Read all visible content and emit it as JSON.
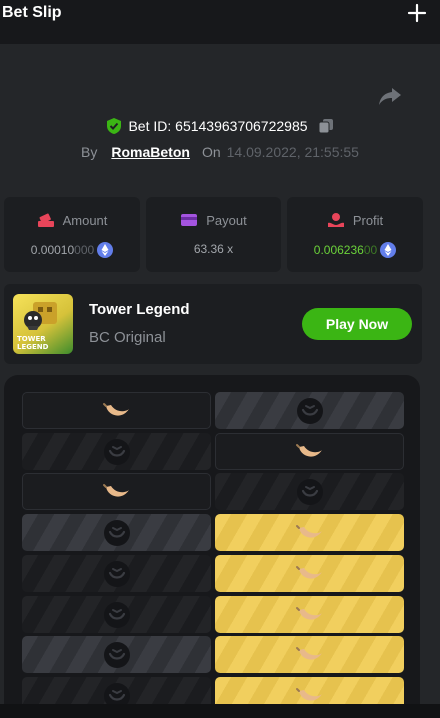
{
  "header": {
    "title": "Bet Slip",
    "add_icon": "plus-icon"
  },
  "bet": {
    "share_icon": "share-icon",
    "id_label": "Bet ID: 65143963706722985",
    "verified_icon": "shield-check-icon",
    "copy_icon": "copy-icon",
    "by_label": "By",
    "user": "RomaBeton",
    "on_label": "On",
    "date": "14.09.2022, 21:55:55"
  },
  "stats": {
    "amount": {
      "label": "Amount",
      "icon": "amount-icon",
      "value_main": "0.00010",
      "value_dim": "000",
      "coin_icon": "eth-icon"
    },
    "payout": {
      "label": "Payout",
      "icon": "wallet-icon",
      "value": "63.36 x"
    },
    "profit": {
      "label": "Profit",
      "icon": "profit-icon",
      "value_main": "0.006236",
      "value_dim": "00",
      "coin_icon": "eth-icon"
    }
  },
  "game": {
    "thumb_text": "TOWER LEGEND",
    "name": "Tower Legend",
    "provider": "BC Original",
    "play_label": "Play Now"
  },
  "board": {
    "rows": [
      [
        "banana-dark",
        "skull-grey"
      ],
      [
        "skull-stripe",
        "banana-dark"
      ],
      [
        "banana-dark",
        "skull-stripe"
      ],
      [
        "skull-grey",
        "banana-gold"
      ],
      [
        "skull-stripe",
        "banana-gold"
      ],
      [
        "skull-stripe",
        "banana-gold"
      ],
      [
        "skull-grey",
        "banana-gold"
      ],
      [
        "skull-stripe",
        "banana-gold"
      ]
    ]
  },
  "colors": {
    "accent_green": "#3bb514",
    "profit_green": "#6bd23a",
    "gold_tile": "#f1cf5e",
    "banana": "#e8b98a"
  }
}
